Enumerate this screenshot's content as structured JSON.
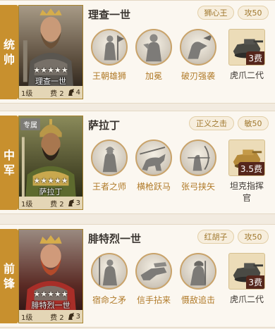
{
  "heroes": [
    {
      "position": [
        "统",
        "帅"
      ],
      "special": "",
      "stars": "★★★★★",
      "name": "理查一世",
      "level": "1级",
      "cost": "费 2",
      "horse": "4",
      "trait": "狮心王",
      "stat": "攻50",
      "skills": [
        "王朝雄狮",
        "加冕",
        "破刃强袭"
      ],
      "gear": {
        "name": "虎爪二代",
        "cost": "3费",
        "icon": "tank-icon"
      }
    },
    {
      "position": [
        "中",
        "军"
      ],
      "special": "专属",
      "stars": "★★★★★",
      "name": "萨拉丁",
      "level": "1级",
      "cost": "费 2",
      "horse": "3",
      "trait": "正义之击",
      "stat": "敏50",
      "skills": [
        "王者之师",
        "横枪跃马",
        "张弓挟矢"
      ],
      "gear": {
        "name": "坦克指挥官",
        "cost": "3.5费",
        "icon": "command-tank-icon"
      }
    },
    {
      "position": [
        "前",
        "锋"
      ],
      "special": "",
      "stars": "★★★★★",
      "name": "腓特烈一世",
      "level": "1级",
      "cost": "费 2",
      "horse": "3",
      "trait": "红胡子",
      "stat": "攻50",
      "skills": [
        "宿命之矛",
        "信手拈来",
        "慑敌追击"
      ],
      "gear": {
        "name": "虎爪二代",
        "cost": "3费",
        "icon": "tank-icon"
      }
    }
  ],
  "colors": {
    "position_tag": "#c8902e",
    "skill_label": "#b07a28",
    "pill_text": "#a0782e",
    "cost_badge": "#55261b"
  }
}
